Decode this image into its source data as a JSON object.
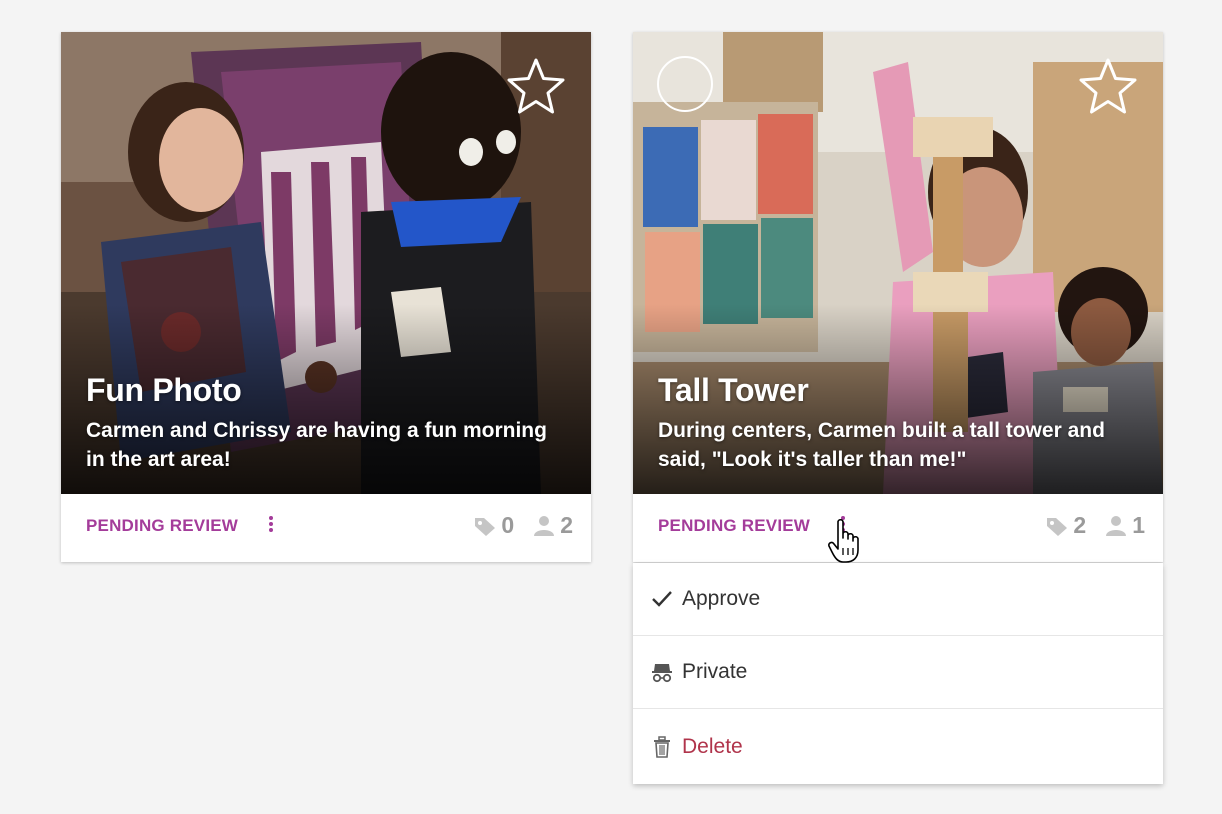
{
  "cards": [
    {
      "title": "Fun Photo",
      "caption": "Carmen and Chrissy are having a fun morning in the art area!",
      "status": "PENDING REVIEW",
      "tag_count": "0",
      "people_count": "2"
    },
    {
      "title": "Tall Tower",
      "caption": "During centers, Carmen built a tall tower and said, \"Look it's taller than me!\"",
      "status": "PENDING REVIEW",
      "tag_count": "2",
      "people_count": "1"
    }
  ],
  "menu": {
    "items": [
      {
        "label": "Approve",
        "icon": "check-icon"
      },
      {
        "label": "Private",
        "icon": "incognito-icon"
      },
      {
        "label": "Delete",
        "icon": "trash-icon"
      }
    ]
  },
  "colors": {
    "accent": "#a43c9a",
    "danger": "#b0344b",
    "count_gray": "#9a9a9a"
  }
}
